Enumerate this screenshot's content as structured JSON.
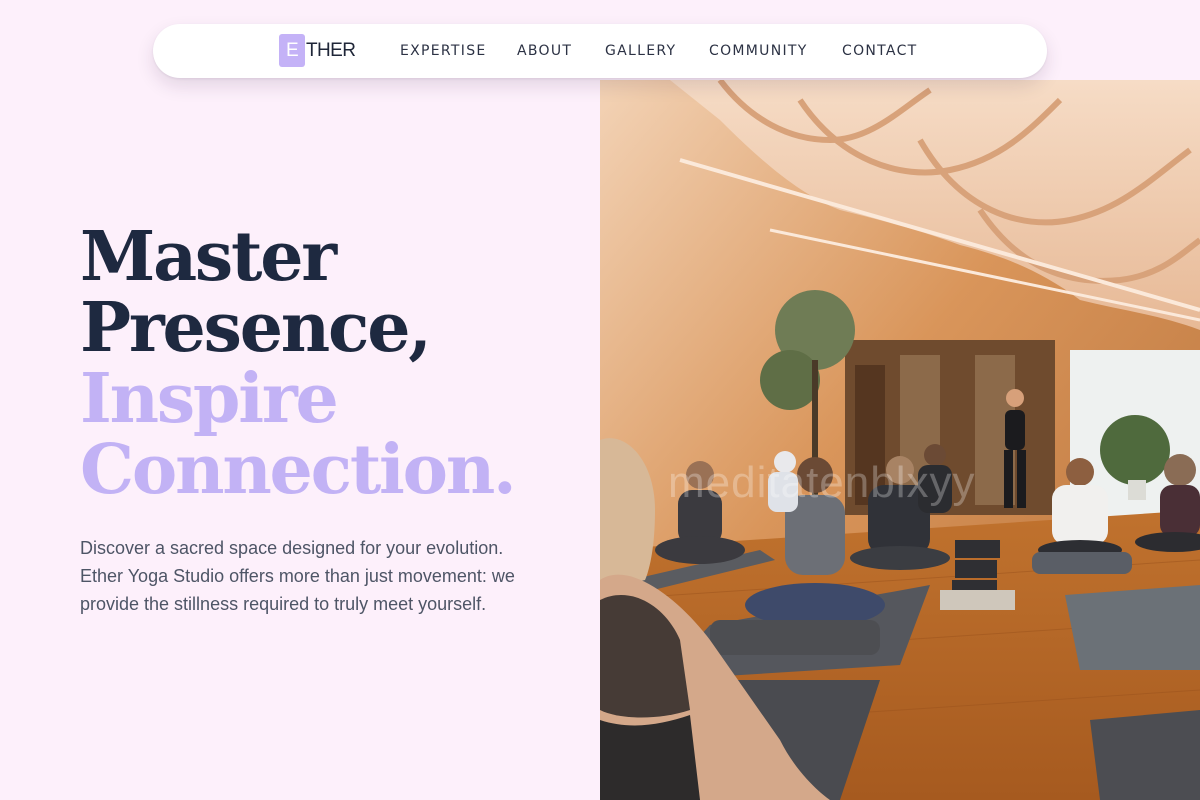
{
  "brand": {
    "mark_letter": "E",
    "name_rest": "THER",
    "accent_color": "#c4b2f7"
  },
  "nav": {
    "items": [
      {
        "label": "EXPERTISE"
      },
      {
        "label": "ABOUT"
      },
      {
        "label": "GALLERY"
      },
      {
        "label": "COMMUNITY"
      },
      {
        "label": "CONTACT"
      }
    ]
  },
  "hero": {
    "line1": "Master",
    "line2": "Presence,",
    "line3": "Inspire",
    "line4": "Connection.",
    "description": "Discover a sacred space designed for your evolution. Ether Yoga Studio offers more than just movement: we provide the stillness required to truly meet yourself.",
    "photo_watermark": "meditatenblxyy"
  },
  "colors": {
    "background": "#fdf0fb",
    "headline_dark": "#1e2940",
    "headline_accent": "#c2b2f5",
    "body_text": "#4e5566"
  }
}
